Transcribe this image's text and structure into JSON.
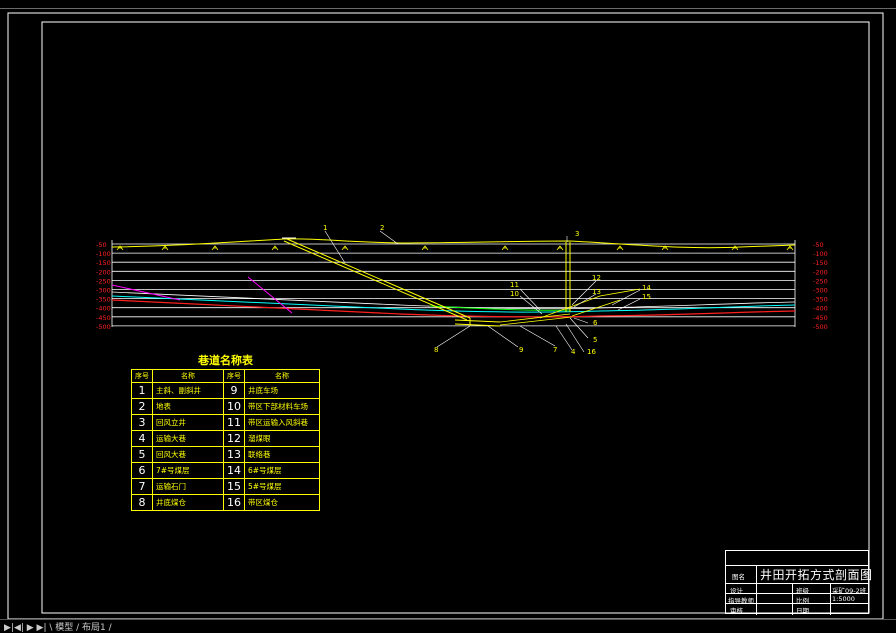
{
  "left_scale": [
    "-50",
    "-100",
    "-150",
    "-200",
    "-250",
    "-300",
    "-350",
    "-400",
    "-450",
    "-500"
  ],
  "right_scale": [
    "-50",
    "-100",
    "-150",
    "-200",
    "-250",
    "-300",
    "-350",
    "-400",
    "-450",
    "-500"
  ],
  "callouts": [
    "1",
    "2",
    "3",
    "12",
    "13",
    "14",
    "15",
    "11",
    "10",
    "5",
    "6",
    "7",
    "4",
    "16",
    "8",
    "9"
  ],
  "legend": {
    "title": "巷道名称表",
    "headers": [
      "序号",
      "名称",
      "序号",
      "名称"
    ],
    "rows": [
      {
        "n1": "1",
        "name1": "主斜、副斜井",
        "n2": "9",
        "name2": "井底车场"
      },
      {
        "n1": "2",
        "name1": "地表",
        "n2": "10",
        "name2": "带区下部材料车场"
      },
      {
        "n1": "3",
        "name1": "回风立井",
        "n2": "11",
        "name2": "带区运输入风斜巷"
      },
      {
        "n1": "4",
        "name1": "运输大巷",
        "n2": "12",
        "name2": "溜煤眼"
      },
      {
        "n1": "5",
        "name1": "回风大巷",
        "n2": "13",
        "name2": "联络巷"
      },
      {
        "n1": "6",
        "name1": "7#号煤层",
        "n2": "14",
        "name2": "6#号煤层"
      },
      {
        "n1": "7",
        "name1": "运输石门",
        "n2": "15",
        "name2": "5#号煤层"
      },
      {
        "n1": "8",
        "name1": "井底煤仓",
        "n2": "16",
        "name2": "带区煤仓"
      }
    ]
  },
  "title_block": {
    "label_name": "图名",
    "drawing_title": "井田开拓方式剖面图",
    "design_label": "设计",
    "teacher_label": "指导教师",
    "review_label": "审核",
    "class_label": "班级",
    "class_value": "采矿09-2班",
    "scale_label": "比例",
    "scale_value": "1:5000",
    "date_label": "日期"
  },
  "tabs": {
    "text": "▶|◀| ▶ ▶| \\ 模型 / 布局1 /"
  },
  "colors": {
    "background": "#000000",
    "frame": "#ffffff",
    "yellow": "#ffff00",
    "red": "#ff2020",
    "cyan": "#00ffff",
    "magenta": "#ff00ff",
    "green": "#00ff00"
  }
}
